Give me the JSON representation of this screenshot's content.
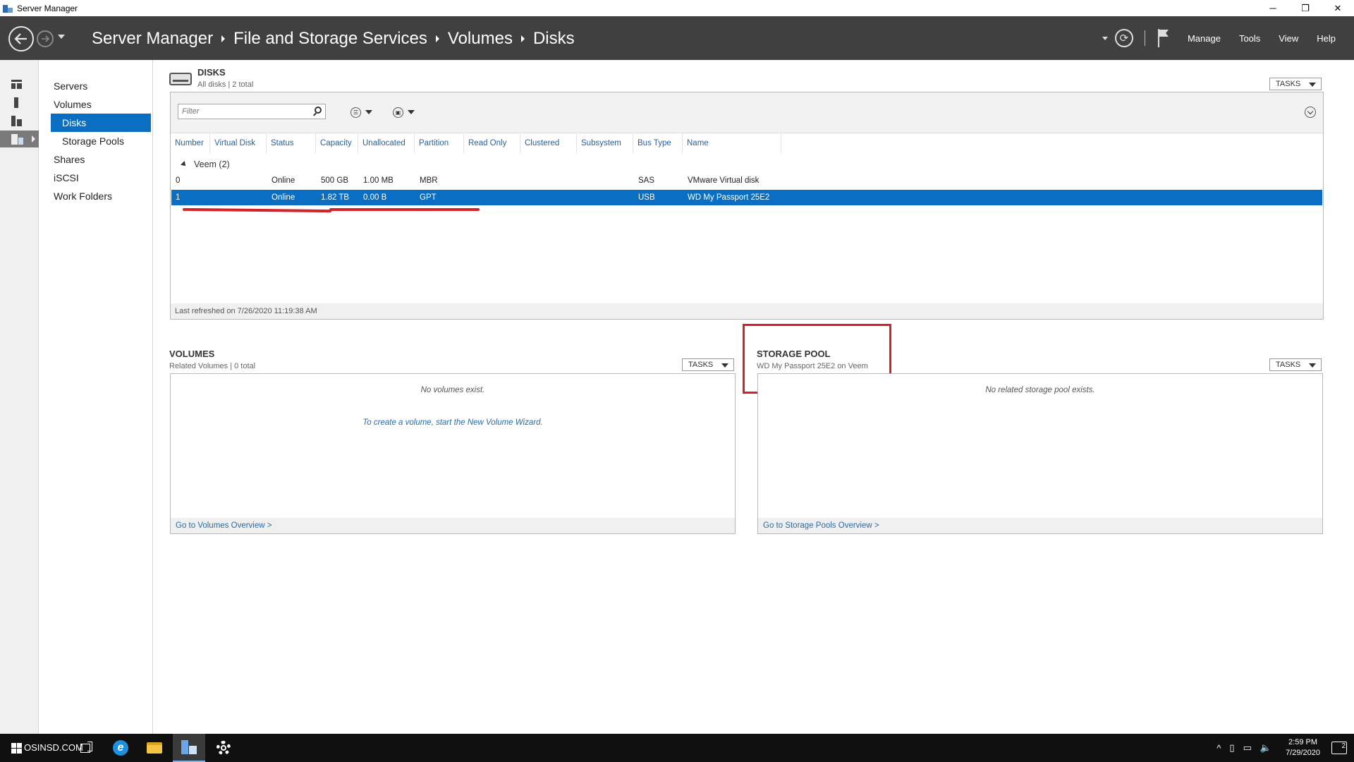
{
  "window": {
    "title": "Server Manager",
    "controls": {
      "minimize": "─",
      "restore": "❐",
      "close": "✕"
    }
  },
  "header": {
    "breadcrumb": [
      "Server Manager",
      "File and Storage Services",
      "Volumes",
      "Disks"
    ],
    "menu": [
      "Manage",
      "Tools",
      "View",
      "Help"
    ]
  },
  "subnav": {
    "items": [
      {
        "label": "Servers",
        "level": 0
      },
      {
        "label": "Volumes",
        "level": 0
      },
      {
        "label": "Disks",
        "level": 1,
        "active": true
      },
      {
        "label": "Storage Pools",
        "level": 1
      },
      {
        "label": "Shares",
        "level": 0
      },
      {
        "label": "iSCSI",
        "level": 0
      },
      {
        "label": "Work Folders",
        "level": 0
      }
    ]
  },
  "disks": {
    "title": "DISKS",
    "subtitle": "All disks | 2 total",
    "tasks_label": "TASKS",
    "filter_placeholder": "Filter",
    "columns": [
      "Number",
      "Virtual Disk",
      "Status",
      "Capacity",
      "Unallocated",
      "Partition",
      "Read Only",
      "Clustered",
      "Subsystem",
      "Bus Type",
      "Name"
    ],
    "group": "Veem (2)",
    "rows": [
      {
        "number": "0",
        "virtual_disk": "",
        "status": "Online",
        "capacity": "500 GB",
        "unallocated": "1.00 MB",
        "partition": "MBR",
        "read_only": "",
        "clustered": "",
        "subsystem": "",
        "bus_type": "SAS",
        "name": "VMware Virtual disk",
        "selected": false
      },
      {
        "number": "1",
        "virtual_disk": "",
        "status": "Online",
        "capacity": "1.82 TB",
        "unallocated": "0.00 B",
        "partition": "GPT",
        "read_only": "",
        "clustered": "",
        "subsystem": "",
        "bus_type": "USB",
        "name": "WD My Passport 25E2",
        "selected": true
      }
    ],
    "footer": "Last refreshed on 7/26/2020 11:19:38 AM"
  },
  "volumes": {
    "title": "VOLUMES",
    "subtitle": "Related Volumes | 0 total",
    "tasks_label": "TASKS",
    "empty_message": "No volumes exist.",
    "wizard_message": "To create a volume, start the New Volume Wizard.",
    "footer_link": "Go to Volumes Overview >"
  },
  "storage_pool": {
    "title": "STORAGE POOL",
    "subtitle": "WD My Passport 25E2 on Veem",
    "tasks_label": "TASKS",
    "empty_message": "No related storage pool exists.",
    "footer_link": "Go to Storage Pools Overview >"
  },
  "taskbar": {
    "watermark": "OSINSD.COM",
    "clock_time": "2:59 PM",
    "clock_date": "7/29/2020",
    "notification_count": "2"
  },
  "colors": {
    "header_bg": "#404040",
    "accent": "#0a6fc2",
    "annotation_red": "#d2232a",
    "link": "#2a6aa8"
  }
}
